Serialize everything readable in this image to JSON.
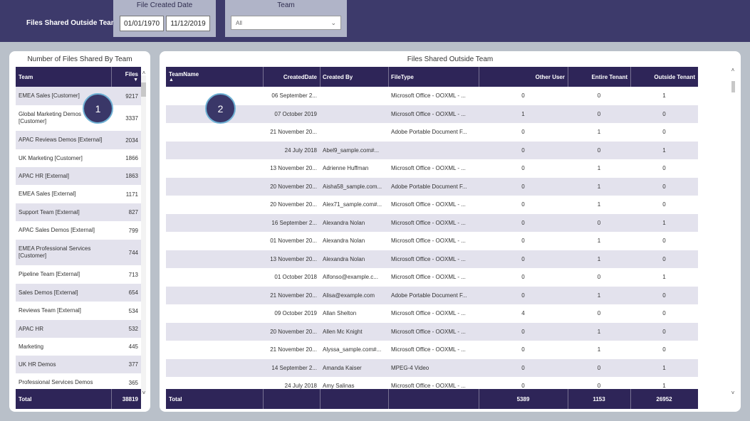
{
  "header": {
    "title": "Files Shared Outside Team",
    "date_slicer": {
      "label": "File Created Date",
      "start": "01/01/1970",
      "end": "11/12/2019"
    },
    "team_slicer": {
      "label": "Team",
      "value": "All"
    }
  },
  "left_table": {
    "title": "Number of Files Shared By Team",
    "columns": [
      "Team",
      "Files"
    ],
    "rows": [
      {
        "team": "EMEA Sales [Customer]",
        "files": "9217"
      },
      {
        "team": "Global Marketing Demos [Customer]",
        "files": "3337"
      },
      {
        "team": "APAC Reviews Demos [External]",
        "files": "2034"
      },
      {
        "team": "UK Marketing [Customer]",
        "files": "1866"
      },
      {
        "team": "APAC HR [External]",
        "files": "1863"
      },
      {
        "team": "EMEA Sales [External]",
        "files": "1171"
      },
      {
        "team": "Support Team [External]",
        "files": "827"
      },
      {
        "team": "APAC Sales Demos [External]",
        "files": "799"
      },
      {
        "team": "EMEA Professional Services [Customer]",
        "files": "744"
      },
      {
        "team": "Pipeline Team [External]",
        "files": "713"
      },
      {
        "team": "Sales Demos [External]",
        "files": "654"
      },
      {
        "team": "Reviews Team [External]",
        "files": "534"
      },
      {
        "team": "APAC HR",
        "files": "532"
      },
      {
        "team": "Marketing",
        "files": "445"
      },
      {
        "team": "UK HR Demos",
        "files": "377"
      },
      {
        "team": "Professional Services Demos",
        "files": "365"
      }
    ],
    "total_label": "Total",
    "total_value": "38819"
  },
  "right_table": {
    "title": "Files Shared Outside Team",
    "columns": [
      "TeamName",
      "CreatedDate",
      "Created By",
      "FileType",
      "Other User",
      "Entire Tenant",
      "Outside Tenant"
    ],
    "rows": [
      {
        "team": "",
        "date": "06 September 2...",
        "by": "",
        "type": "Microsoft Office - OOXML - ...",
        "other": "0",
        "entire": "0",
        "outside": "1"
      },
      {
        "team": "",
        "date": "07 October 2019",
        "by": "",
        "type": "Microsoft Office - OOXML - ...",
        "other": "1",
        "entire": "0",
        "outside": "0"
      },
      {
        "team": "",
        "date": "21 November 20...",
        "by": "",
        "type": "Adobe Portable Document F...",
        "other": "0",
        "entire": "1",
        "outside": "0"
      },
      {
        "team": "",
        "date": "24 July 2018",
        "by": "Abel9_sample.com#...",
        "type": "",
        "other": "0",
        "entire": "0",
        "outside": "1"
      },
      {
        "team": "",
        "date": "13 November 20...",
        "by": "Adrienne Huffman",
        "type": "Microsoft Office - OOXML - ...",
        "other": "0",
        "entire": "1",
        "outside": "0"
      },
      {
        "team": "",
        "date": "20 November 20...",
        "by": "Aisha58_sample.com...",
        "type": "Adobe Portable Document F...",
        "other": "0",
        "entire": "1",
        "outside": "0"
      },
      {
        "team": "",
        "date": "20 November 20...",
        "by": "Alex71_sample.com#...",
        "type": "Microsoft Office - OOXML - ...",
        "other": "0",
        "entire": "1",
        "outside": "0"
      },
      {
        "team": "",
        "date": "16 September 2...",
        "by": "Alexandra Nolan",
        "type": "Microsoft Office - OOXML - ...",
        "other": "0",
        "entire": "0",
        "outside": "1"
      },
      {
        "team": "",
        "date": "01 November 20...",
        "by": "Alexandra Nolan",
        "type": "Microsoft Office - OOXML - ...",
        "other": "0",
        "entire": "1",
        "outside": "0"
      },
      {
        "team": "",
        "date": "13 November 20...",
        "by": "Alexandra Nolan",
        "type": "Microsoft Office - OOXML - ...",
        "other": "0",
        "entire": "1",
        "outside": "0"
      },
      {
        "team": "",
        "date": "01 October 2018",
        "by": "Alfonso@example.c...",
        "type": "Microsoft Office - OOXML - ...",
        "other": "0",
        "entire": "0",
        "outside": "1"
      },
      {
        "team": "",
        "date": "21 November 20...",
        "by": "Alisa@example.com",
        "type": "Adobe Portable Document F...",
        "other": "0",
        "entire": "1",
        "outside": "0"
      },
      {
        "team": "",
        "date": "09 October 2019",
        "by": "Allan Shelton",
        "type": "Microsoft Office - OOXML - ...",
        "other": "4",
        "entire": "0",
        "outside": "0"
      },
      {
        "team": "",
        "date": "20 November 20...",
        "by": "Allen Mc Knight",
        "type": "Microsoft Office - OOXML - ...",
        "other": "0",
        "entire": "1",
        "outside": "0"
      },
      {
        "team": "",
        "date": "21 November 20...",
        "by": "Alyssa_sample.com#...",
        "type": "Microsoft Office - OOXML - ...",
        "other": "0",
        "entire": "1",
        "outside": "0"
      },
      {
        "team": "",
        "date": "14 September 2...",
        "by": "Amanda Kaiser",
        "type": "MPEG-4 Video",
        "other": "0",
        "entire": "0",
        "outside": "1"
      },
      {
        "team": "",
        "date": "24 July 2018",
        "by": "Amy Salinas",
        "type": "Microsoft Office - OOXML - ...",
        "other": "0",
        "entire": "0",
        "outside": "1"
      }
    ],
    "total_label": "Total",
    "totals": {
      "other": "5389",
      "entire": "1153",
      "outside": "26952"
    }
  },
  "badges": [
    "1",
    "2"
  ],
  "colors": {
    "header_bg": "#3d3a6b",
    "table_header": "#2e2558",
    "alt_row": "#e3e2ed",
    "page_bg": "#b9c0c9"
  }
}
